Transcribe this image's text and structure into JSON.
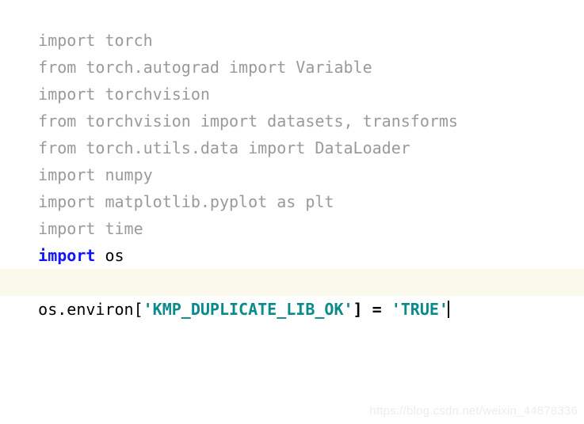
{
  "editor": {
    "background_color": "#ffffff",
    "dim_color": "#9a9a9e",
    "keyword_color": "#1414ff",
    "string_color": "#0a8a8a",
    "plain_color": "#000000",
    "highlight_color": "#fbf9ec",
    "lines": [
      {
        "text": "import torch"
      },
      {
        "text": "from torch.autograd import Variable"
      },
      {
        "text": "import torchvision"
      },
      {
        "text": "from torchvision import datasets, transforms"
      },
      {
        "text": "from torch.utils.data import DataLoader"
      },
      {
        "text": "import numpy"
      },
      {
        "text": "import matplotlib.pyplot as plt"
      },
      {
        "text": "import time"
      }
    ],
    "active_import": {
      "keyword": "import",
      "space": " ",
      "module": "os"
    },
    "highlighted_line": {
      "prefix": "os.environ[",
      "key_string": "'KMP_DUPLICATE_LIB_OK'",
      "close_bracket": "]",
      "operator": " = ",
      "value_string": "'TRUE'"
    }
  },
  "watermark": {
    "text": "https://blog.csdn.net/weixin_44878336"
  }
}
